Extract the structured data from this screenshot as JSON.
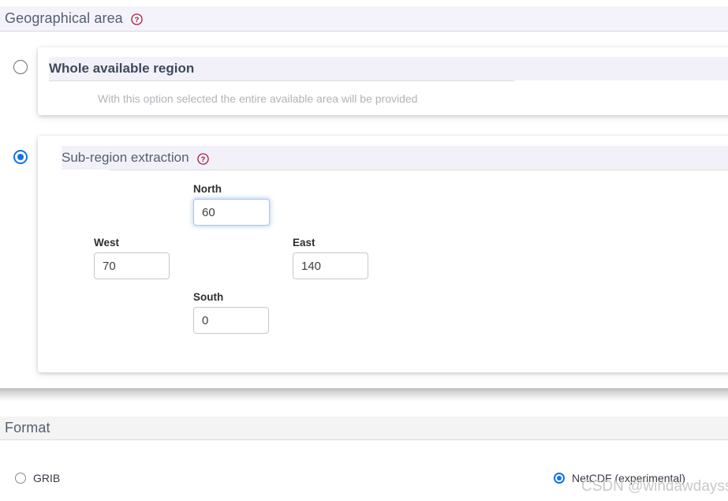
{
  "geographical_area": {
    "header_title": "Geographical area",
    "help_icon": "question-mark-circle-icon",
    "options": [
      {
        "id": "whole-available-region",
        "title": "Whole available region",
        "description": "With this option selected the entire available area will be provided",
        "selected": false
      },
      {
        "id": "sub-region-extraction",
        "title": "Sub-region extraction",
        "help_icon": "question-mark-circle-icon",
        "selected": true,
        "fields": {
          "north": {
            "label": "North",
            "value": "60",
            "focused": true
          },
          "west": {
            "label": "West",
            "value": "70",
            "focused": false
          },
          "east": {
            "label": "East",
            "value": "140",
            "focused": false
          },
          "south": {
            "label": "South",
            "value": "0",
            "focused": false
          }
        }
      }
    ]
  },
  "format": {
    "header_title": "Format",
    "options": [
      {
        "id": "grib",
        "label": "GRIB",
        "selected": false
      },
      {
        "id": "netcdf",
        "label": "NetCDF (experimental)",
        "selected": true
      }
    ]
  },
  "watermark": {
    "text": "CSDN @windawdaysss"
  },
  "colors": {
    "accent_blue": "#1272e3",
    "help_icon_red": "#a01134",
    "header_lavender": "#f4f3fb",
    "header_grey": "#f4f4f5",
    "title_text": "#55606e"
  }
}
